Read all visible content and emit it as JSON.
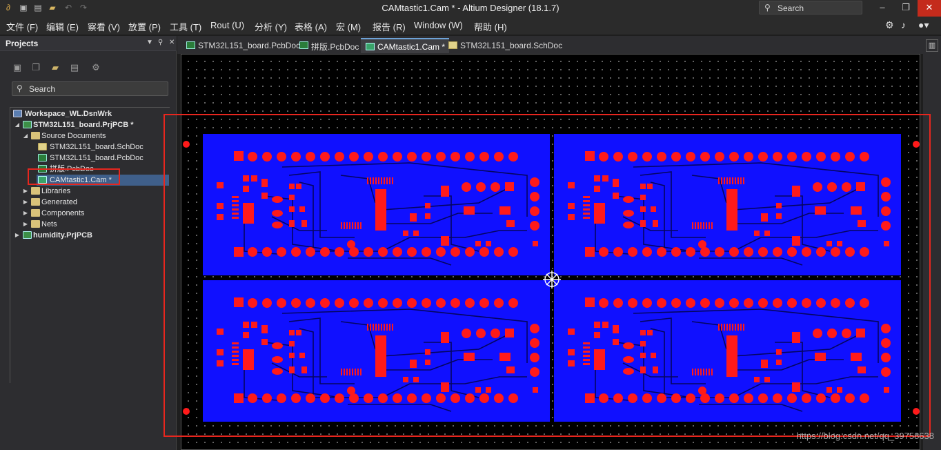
{
  "window": {
    "title": "CAMtastic1.Cam * - Altium Designer (18.1.7)",
    "search_label": "Search",
    "minimize": "–",
    "maximize": "❐",
    "close": "✕"
  },
  "quick_access": [
    "save-icon",
    "save-all-icon",
    "open-icon",
    "undo-icon",
    "redo-icon"
  ],
  "menu": [
    "文件 (F)",
    "编辑 (E)",
    "察看 (V)",
    "放置 (P)",
    "工具 (T)",
    "Rout (U)",
    "分析 (Y)",
    "表格 (A)",
    "宏 (M)",
    "报告 (R)",
    "Window (W)",
    "帮助 (H)"
  ],
  "panel": {
    "title": "Projects",
    "search_placeholder": "Search",
    "tree": [
      {
        "label": "Workspace_WL.DsnWrk",
        "bold": true,
        "icon": "workspace-icon"
      },
      {
        "label": "STM32L151_board.PrjPCB *",
        "bold": true,
        "icon": "project-icon"
      },
      {
        "label": "Source Documents",
        "icon": "folder-icon"
      },
      {
        "label": "STM32L151_board.SchDoc",
        "icon": "schematic-doc-icon"
      },
      {
        "label": "STM32L151_board.PcbDoc",
        "icon": "pcb-doc-icon"
      },
      {
        "label": "拼版.PcbDoc",
        "icon": "pcb-doc-icon"
      },
      {
        "label": "CAMtastic1.Cam *",
        "icon": "cam-doc-icon",
        "selected": true
      },
      {
        "label": "Libraries",
        "icon": "folder-icon"
      },
      {
        "label": "Generated",
        "icon": "folder-icon"
      },
      {
        "label": "Components",
        "icon": "folder-icon"
      },
      {
        "label": "Nets",
        "icon": "folder-icon"
      },
      {
        "label": "humidity.PrjPCB",
        "bold": true,
        "icon": "project-icon"
      }
    ]
  },
  "tabs": [
    {
      "label": "STM32L151_board.PcbDoc",
      "icon": "pcb-doc-icon"
    },
    {
      "label": "拼版.PcbDoc",
      "icon": "pcb-doc-icon"
    },
    {
      "label": "CAMtastic1.Cam *",
      "icon": "cam-doc-icon",
      "active": true
    },
    {
      "label": "STM32L151_board.SchDoc",
      "icon": "schematic-doc-icon"
    }
  ],
  "canvas": {
    "board_color": "#1010ff",
    "pad_color": "#ff1a1a",
    "panel_count": 4
  },
  "watermark": "https://blog.csdn.net/qq_39758638"
}
